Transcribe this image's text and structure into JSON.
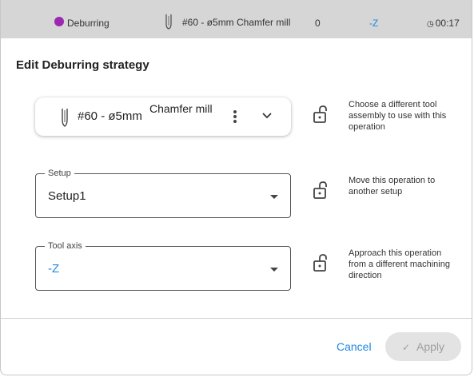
{
  "operation_bar": {
    "strategy": "Deburring",
    "strategy_color": "#9c27b0",
    "tool": "#60 - ø5mm Chamfer mill",
    "count": "0",
    "axis": "-Z",
    "time": "00:17"
  },
  "dialog": {
    "title": "Edit Deburring strategy"
  },
  "tool_selector": {
    "number": "#60 - ø5mm",
    "description": "Chamfer mill",
    "help": "Choose a different tool assembly to use with this operation"
  },
  "setup": {
    "label": "Setup",
    "value": "Setup1",
    "help": "Move this operation to another setup"
  },
  "tool_axis": {
    "label": "Tool axis",
    "value": "-Z",
    "help": "Approach this operation from a different machining direction"
  },
  "footer": {
    "cancel_label": "Cancel",
    "apply_label": "Apply"
  },
  "colors": {
    "accent": "#1e88e5",
    "bar_background": "#d6d6d6"
  }
}
